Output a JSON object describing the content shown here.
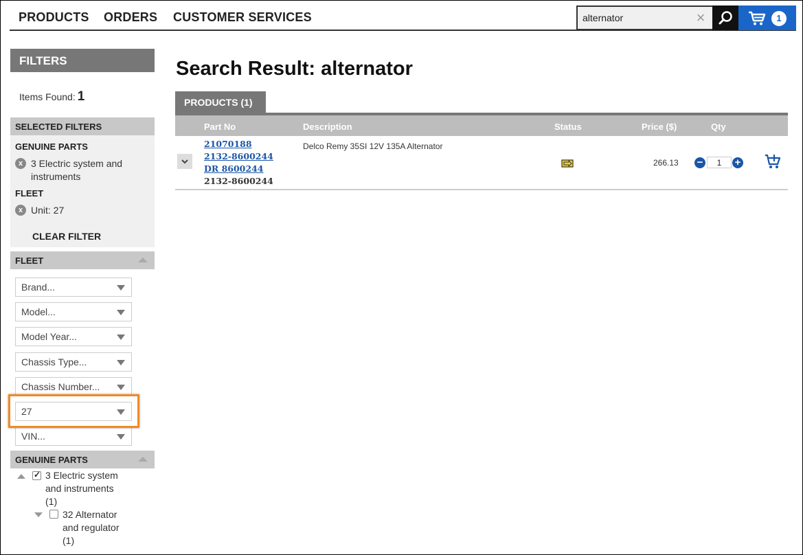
{
  "nav": {
    "products": "PRODUCTS",
    "orders": "ORDERS",
    "customer_services": "CUSTOMER SERVICES"
  },
  "search": {
    "value": "alternator",
    "clear_icon": "close-icon",
    "search_icon": "magnifier-icon"
  },
  "cart": {
    "icon": "cart-icon",
    "count": "1"
  },
  "sidebar": {
    "filters_title": "FILTERS",
    "items_found_label": "Items Found:",
    "items_found_count": "1",
    "selected_filters_title": "SELECTED FILTERS",
    "selected": [
      {
        "group": "GENUINE PARTS",
        "value": "3 Electric system and instruments"
      },
      {
        "group": "FLEET",
        "value": "Unit: 27"
      }
    ],
    "clear_filter": "CLEAR FILTER",
    "fleet_title": "FLEET",
    "fleet_selects": [
      "Brand...",
      "Model...",
      "Model Year...",
      "Chassis Type...",
      "Chassis Number...",
      "27",
      "VIN..."
    ],
    "genuine_parts_title": "GENUINE PARTS",
    "tree": [
      {
        "label": "3 Electric system and instruments (1)",
        "checked": true
      },
      {
        "label": "32 Alternator and regulator (1)",
        "checked": false
      }
    ]
  },
  "main": {
    "title": "Search Result: alternator",
    "tab": "PRODUCTS (1)",
    "columns": {
      "part_no": "Part No",
      "description": "Description",
      "status": "Status",
      "price": "Price ($)",
      "qty": "Qty"
    },
    "rows": [
      {
        "part_links": [
          "21070188",
          "2132-8600244",
          "DR 8600244"
        ],
        "part_plain": "2132-8600244",
        "description": "Delco Remy 35SI 12V 135A Alternator",
        "status_icon": "stock-status-icon",
        "price": "266.13",
        "qty": "1"
      }
    ]
  },
  "colors": {
    "accent_blue": "#1a66c8",
    "link_blue": "#1a56a8",
    "highlight_orange": "#f08a24",
    "header_gray": "#777777"
  }
}
